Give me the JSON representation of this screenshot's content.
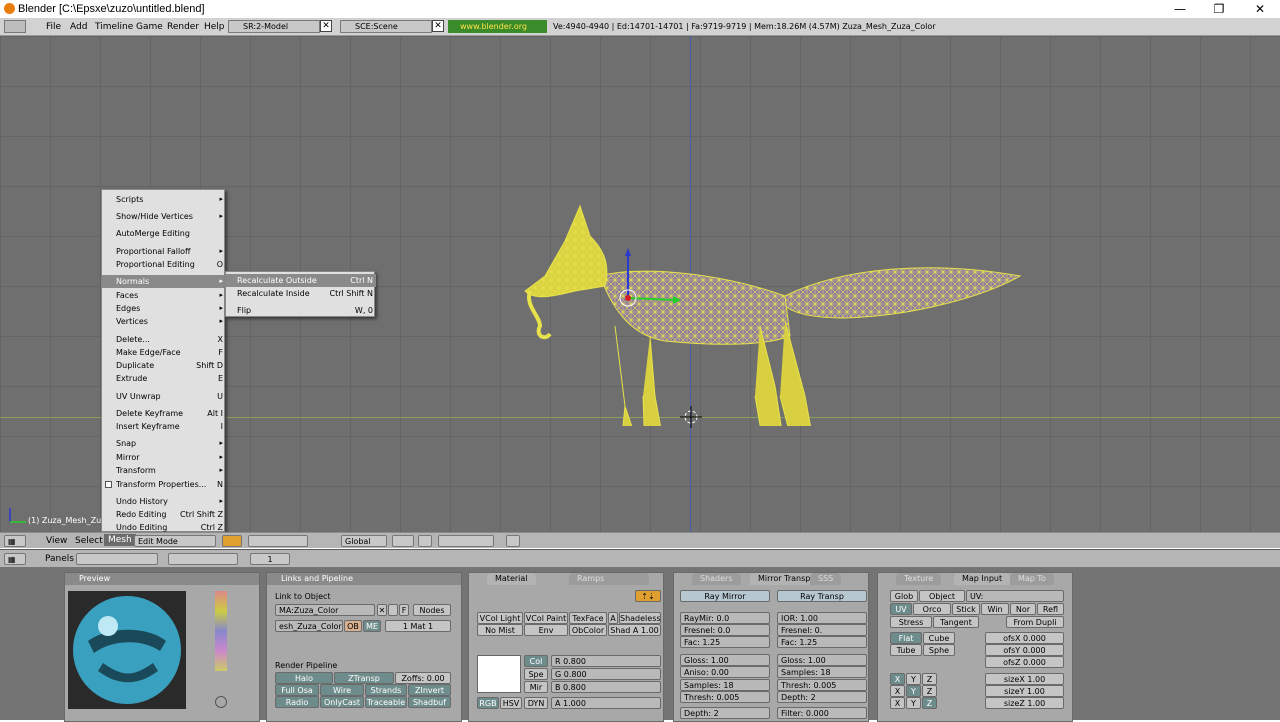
{
  "window": {
    "title": "Blender [C:\\Epsxe\\zuzo\\untitled.blend]",
    "min": "—",
    "max": "❐",
    "close": "✕"
  },
  "info": {
    "menus": [
      "File",
      "Add",
      "Timeline",
      "Game",
      "Render",
      "Help"
    ],
    "screen": "SR:2-Model",
    "scene": "SCE:Scene",
    "url": "www.blender.org 249.2",
    "stats": "Ve:4940-4940 | Ed:14701-14701 | Fa:9719-9719 | Mem:18.26M (4.57M) Zuza_Mesh_Zuza_Color"
  },
  "viewport": {
    "object_label": "(1) Zuza_Mesh_Zuza_C"
  },
  "mesh_menu": [
    {
      "label": "Scripts",
      "shortcut": "",
      "arrow": "▸"
    },
    {
      "label": "Show/Hide Vertices",
      "shortcut": "",
      "arrow": "▸"
    },
    {
      "label": "AutoMerge Editing",
      "shortcut": "",
      "arrow": ""
    },
    {
      "label": "Proportional Falloff",
      "shortcut": "",
      "arrow": "▸"
    },
    {
      "label": "Proportional Editing",
      "shortcut": "O",
      "arrow": ""
    },
    {
      "label": "Normals",
      "shortcut": "",
      "arrow": "▸"
    },
    {
      "label": "Faces",
      "shortcut": "",
      "arrow": "▸"
    },
    {
      "label": "Edges",
      "shortcut": "",
      "arrow": "▸"
    },
    {
      "label": "Vertices",
      "shortcut": "",
      "arrow": "▸"
    },
    {
      "label": "Delete...",
      "shortcut": "X",
      "arrow": ""
    },
    {
      "label": "Make Edge/Face",
      "shortcut": "F",
      "arrow": ""
    },
    {
      "label": "Duplicate",
      "shortcut": "Shift D",
      "arrow": ""
    },
    {
      "label": "Extrude",
      "shortcut": "E",
      "arrow": ""
    },
    {
      "label": "UV Unwrap",
      "shortcut": "U",
      "arrow": ""
    },
    {
      "label": "Delete Keyframe",
      "shortcut": "Alt I",
      "arrow": ""
    },
    {
      "label": "Insert Keyframe",
      "shortcut": "I",
      "arrow": ""
    },
    {
      "label": "Snap",
      "shortcut": "",
      "arrow": "▸"
    },
    {
      "label": "Mirror",
      "shortcut": "",
      "arrow": "▸"
    },
    {
      "label": "Transform",
      "shortcut": "",
      "arrow": "▸"
    },
    {
      "label": "Transform Properties...",
      "shortcut": "N",
      "arrow": ""
    },
    {
      "label": "Undo History",
      "shortcut": "",
      "arrow": "▸"
    },
    {
      "label": "Redo Editing",
      "shortcut": "Ctrl Shift Z",
      "arrow": ""
    },
    {
      "label": "Undo Editing",
      "shortcut": "Ctrl Z",
      "arrow": ""
    }
  ],
  "normals_submenu": [
    {
      "label": "Recalculate Outside",
      "shortcut": "Ctrl N"
    },
    {
      "label": "Recalculate Inside",
      "shortcut": "Ctrl Shift N"
    },
    {
      "label": "Flip",
      "shortcut": "W, 0"
    }
  ],
  "view_header": {
    "menus": [
      "View",
      "Select",
      "Mesh"
    ],
    "mode": "Edit Mode",
    "orientation": "Global"
  },
  "buttons_header": {
    "panels": "Panels",
    "frame": "1"
  },
  "preview": {
    "title": "Preview"
  },
  "link": {
    "title": "Links and Pipeline",
    "link_to_object": "Link to Object",
    "material": "MA:Zuza_Color",
    "f": "F",
    "nodes": "Nodes",
    "mesh": "esh_Zuza_Color",
    "ob": "OB",
    "me": "ME",
    "mat": "1 Mat 1",
    "render_pipeline": "Render Pipeline",
    "rows": [
      [
        "Halo",
        "ZTransp",
        "Zoffs: 0.00"
      ],
      [
        "Full Osa",
        "Wire",
        "Strands",
        "ZInvert"
      ],
      [
        "Radio",
        "OnlyCast",
        "Traceable",
        "Shadbuf"
      ]
    ]
  },
  "material": {
    "tab": "Material",
    "tab2": "Ramps",
    "row1": [
      "VCol Light",
      "VCol Paint",
      "TexFace",
      "A",
      "Shadeless"
    ],
    "row2": [
      "No Mist",
      "Env",
      "ObColor",
      "Shad A 1.00"
    ],
    "col": "Col",
    "spe": "Spe",
    "mir": "Mir",
    "r": "R 0.800",
    "g": "G 0.800",
    "bb": "B 0.800",
    "a": "A 1.000",
    "rgb": "RGB",
    "hsv": "HSV",
    "dyn": "DYN"
  },
  "shaders": {
    "tabs": [
      "Shaders",
      "Mirror Transp",
      "SSS"
    ],
    "ray_mirror": "Ray Mirror",
    "ray_transp": "Ray Transp",
    "left": [
      "RayMir: 0.0",
      "Fresnel: 0.0",
      "Fac: 1.25",
      "Gloss: 1.00",
      "Aniso: 0.00",
      "Samples: 18",
      "Thresh: 0.005",
      "Depth: 2"
    ],
    "right": [
      "IOR: 1.00",
      "Fresnel: 0.",
      "Fac: 1.25",
      "Gloss: 1.00",
      "Samples: 18",
      "Thresh: 0.005",
      "Depth: 2",
      "Filter: 0.000"
    ]
  },
  "texture": {
    "tabs": [
      "Texture",
      "Map Input",
      "Map To"
    ],
    "row1": [
      "Glob",
      "Object",
      "UV:"
    ],
    "row2": [
      "UV",
      "Orco",
      "Stick",
      "Win",
      "Nor",
      "Refl"
    ],
    "row3": [
      "Stress",
      "Tangent",
      "From Dupli"
    ],
    "flat": "Flat",
    "cube": "Cube",
    "tube": "Tube",
    "sphe": "Sphe",
    "ofs": [
      "ofsX 0.000",
      "ofsY 0.000",
      "ofsZ 0.000"
    ],
    "size": [
      "sizeX 1.00",
      "sizeY 1.00",
      "sizeZ 1.00"
    ],
    "xyz": [
      "X",
      "Y",
      "Z"
    ]
  }
}
